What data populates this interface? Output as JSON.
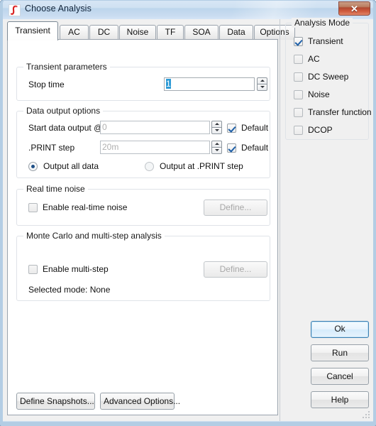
{
  "window": {
    "title": "Choose Analysis",
    "app_icon": "integral-icon",
    "close_label": "✕"
  },
  "tabs": [
    {
      "label": "Transient",
      "selected": true
    },
    {
      "label": "AC",
      "selected": false
    },
    {
      "label": "DC",
      "selected": false
    },
    {
      "label": "Noise",
      "selected": false
    },
    {
      "label": "TF",
      "selected": false
    },
    {
      "label": "SOA",
      "selected": false
    },
    {
      "label": "Data",
      "selected": false
    },
    {
      "label": "Options",
      "selected": false
    }
  ],
  "transient_parameters": {
    "legend": "Transient parameters",
    "stop_time_label": "Stop time",
    "stop_time_value": "1",
    "stop_time_placeholder": ""
  },
  "data_output_options": {
    "legend": "Data output options",
    "start_label": "Start data output @",
    "start_value": "0",
    "start_default_label": "Default",
    "print_label": ".PRINT step",
    "print_value": "20m",
    "print_default_label": "Default",
    "radio_all_label": "Output all data",
    "radio_print_label": "Output at .PRINT step"
  },
  "real_time_noise": {
    "legend": "Real time noise",
    "enable_label": "Enable real-time noise",
    "define_label": "Define..."
  },
  "monte_carlo": {
    "legend": "Monte Carlo and multi-step analysis",
    "enable_label": "Enable multi-step",
    "define_label": "Define...",
    "selected_mode": "Selected mode: None"
  },
  "bottom_buttons": {
    "snapshots_label": "Define Snapshots...",
    "advanced_label": "Advanced Options..."
  },
  "analysis_mode": {
    "legend": "Analysis Mode",
    "items": [
      {
        "label": "Transient",
        "checked": true
      },
      {
        "label": "AC",
        "checked": false
      },
      {
        "label": "DC Sweep",
        "checked": false
      },
      {
        "label": "Noise",
        "checked": false
      },
      {
        "label": "Transfer function",
        "checked": false
      },
      {
        "label": "DCOP",
        "checked": false
      }
    ]
  },
  "action_buttons": {
    "ok_label": "Ok",
    "run_label": "Run",
    "cancel_label": "Cancel",
    "help_label": "Help"
  },
  "colors": {
    "title_bar": "#cfe1f2",
    "close_red": "#b04a32",
    "selection_blue": "#2e9bd6",
    "default_focus_blue": "#3c7fb1",
    "panel_gray": "#f0f0f0",
    "page_white": "#ffffff"
  }
}
